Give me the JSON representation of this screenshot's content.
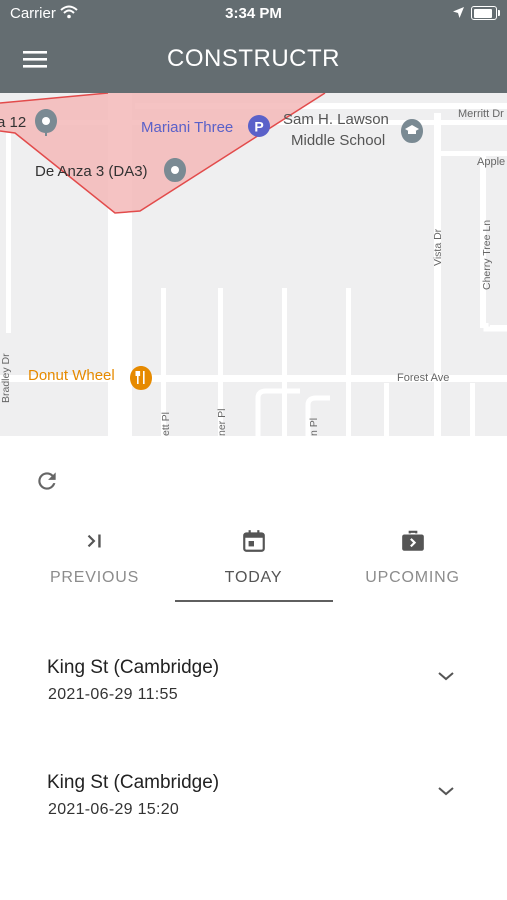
{
  "status_bar": {
    "carrier": "Carrier",
    "time": "3:34 PM",
    "battery_level": 1.0
  },
  "app": {
    "title": "CONSTRUCTR"
  },
  "map": {
    "labels": {
      "site_12": "a 12",
      "mariani": "Mariani Three",
      "lawson_line1": "Sam H. Lawson",
      "lawson_line2": "Middle School",
      "merritt": "Merritt Dr",
      "de_anza": "De Anza 3 (DA3)",
      "apple": "Apple",
      "vista": "Vista Dr",
      "cherry": "Cherry Tree Ln",
      "donut": "Donut Wheel",
      "forest": "Forest Ave",
      "bradley": "Bradley Dr",
      "ett": "ett Pl",
      "ner": "ner Pl",
      "n_pl": "n Pl"
    }
  },
  "tabs": [
    {
      "label": "PREVIOUS",
      "icon": "skip-next-icon"
    },
    {
      "label": "TODAY",
      "icon": "calendar-today-icon",
      "active": true
    },
    {
      "label": "UPCOMING",
      "icon": "upcoming-briefcase-icon"
    }
  ],
  "visits": [
    {
      "location": "King St (Cambridge)",
      "datetime": "2021-06-29 11:55"
    },
    {
      "location": "King St (Cambridge)",
      "datetime": "2021-06-29 15:20"
    }
  ],
  "colors": {
    "header": "#646d71",
    "map_bg": "#efeff0",
    "zone_fill": "#f3b9b9",
    "zone_stroke": "#e24b4b",
    "poi_blue": "#5a61c9",
    "poi_orange": "#e68a00"
  }
}
